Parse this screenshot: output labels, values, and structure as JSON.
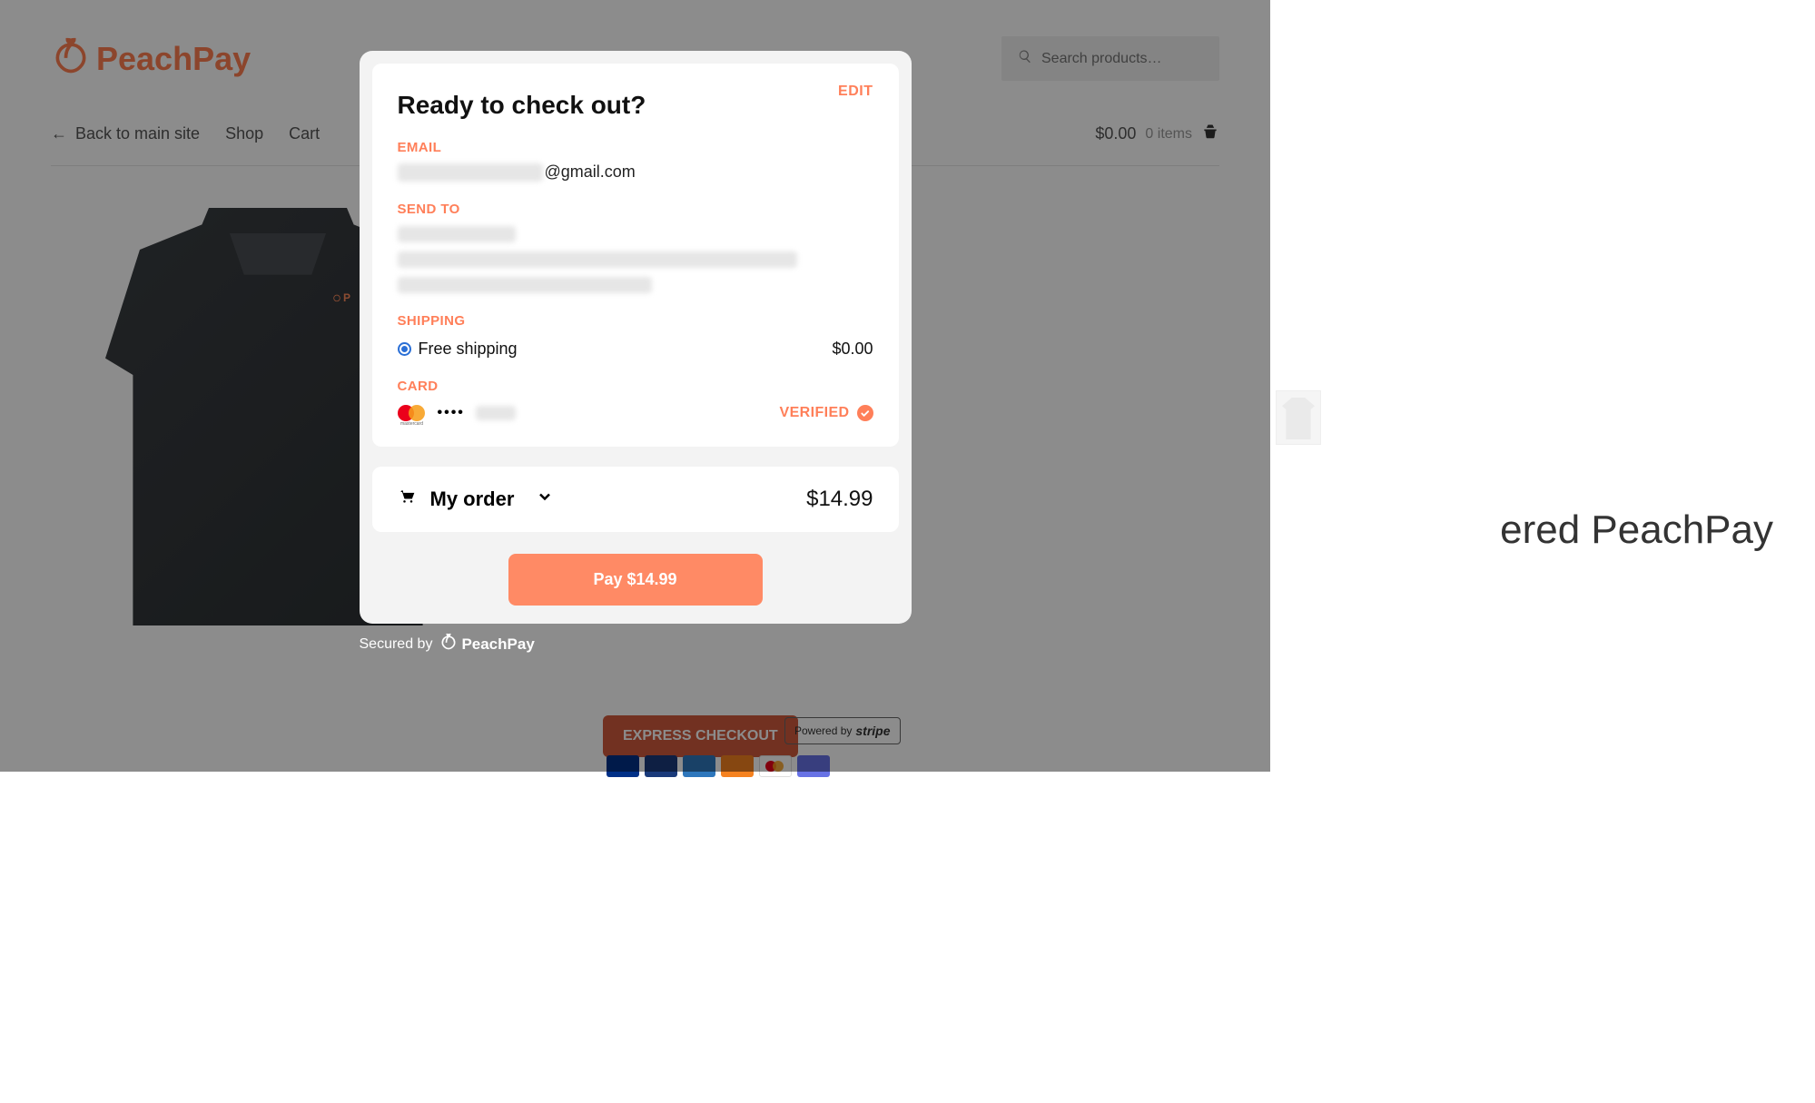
{
  "brand": {
    "name": "PeachPay"
  },
  "search": {
    "placeholder": "Search products…"
  },
  "nav": {
    "back": "Back to main site",
    "shop": "Shop",
    "cart": "Cart"
  },
  "cart": {
    "total": "$0.00",
    "items_label": "0 items"
  },
  "product": {
    "title_partial": "ered PeachPay"
  },
  "express": {
    "label": "EXPRESS CHECKOUT"
  },
  "stripe": {
    "powered_by": "Powered by",
    "brand": "stripe"
  },
  "modal": {
    "title": "Ready to check out?",
    "edit": "EDIT",
    "labels": {
      "email": "EMAIL",
      "send_to": "SEND TO",
      "shipping": "SHIPPING",
      "card": "CARD"
    },
    "email_domain": "@gmail.com",
    "shipping": {
      "option": "Free shipping",
      "price": "$0.00"
    },
    "card": {
      "dots": "••••",
      "brand_label": "mastercard",
      "verified": "VERIFIED"
    },
    "order": {
      "label": "My order",
      "total": "$14.99"
    },
    "pay_button": "Pay $14.99"
  },
  "secured": {
    "prefix": "Secured by",
    "brand": "PeachPay"
  }
}
